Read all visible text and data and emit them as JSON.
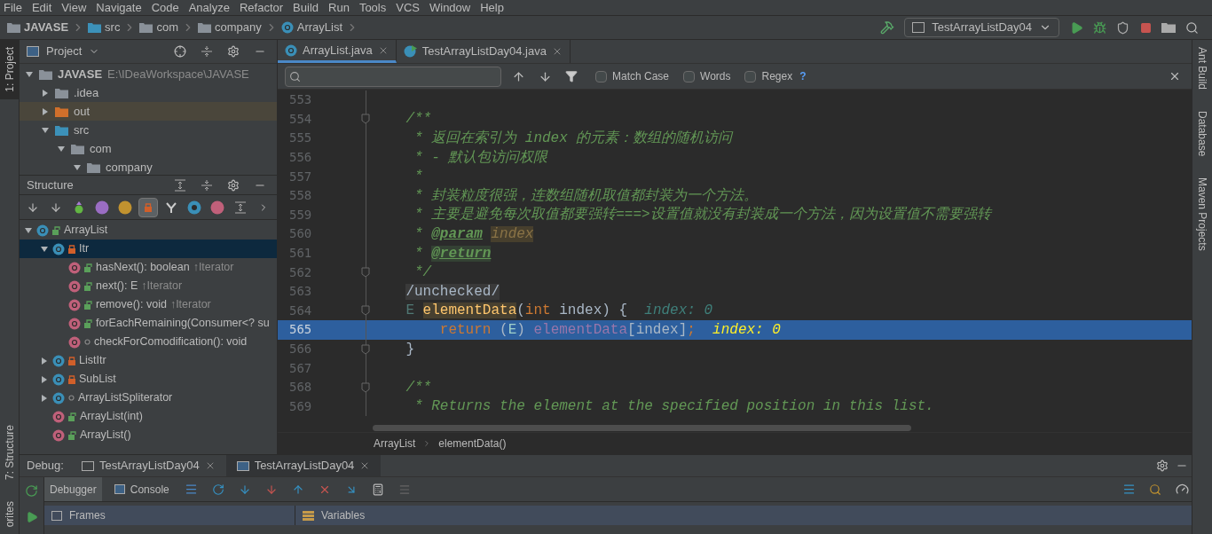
{
  "menu": [
    "File",
    "Edit",
    "View",
    "Navigate",
    "Code",
    "Analyze",
    "Refactor",
    "Build",
    "Run",
    "Tools",
    "VCS",
    "Window",
    "Help"
  ],
  "nav_breadcrumbs": [
    {
      "label": "JAVASE",
      "kind": "project"
    },
    {
      "label": "src",
      "kind": "source"
    },
    {
      "label": "com",
      "kind": "package"
    },
    {
      "label": "company",
      "kind": "package"
    },
    {
      "label": "ArrayList",
      "kind": "class"
    }
  ],
  "run_config": {
    "label": "TestArrayListDay04"
  },
  "left_strip": {
    "top": [
      {
        "label": "1: Project",
        "selected": true
      }
    ],
    "bottom": [
      {
        "label": "7: Structure",
        "selected": false
      },
      {
        "label": "orites",
        "selected": false
      }
    ]
  },
  "project_panel": {
    "title": "Project",
    "tree": [
      {
        "label": "JAVASE",
        "path": "E:\\IDeaWorkspace\\JAVASE",
        "kind": "project",
        "expanded": true,
        "children": [
          {
            "label": ".idea",
            "kind": "folder",
            "expanded": false
          },
          {
            "label": "out",
            "kind": "excluded_folder",
            "expanded": false
          },
          {
            "label": "src",
            "kind": "source",
            "expanded": true,
            "children": [
              {
                "label": "com",
                "kind": "package",
                "expanded": true,
                "children": [
                  {
                    "label": "company",
                    "kind": "package",
                    "expanded": true
                  }
                ]
              }
            ]
          }
        ]
      }
    ]
  },
  "structure_panel": {
    "title": "Structure",
    "tree": [
      {
        "label": "ArrayList",
        "kind": "public_class",
        "expanded": true,
        "selected": false,
        "children": [
          {
            "label": "Itr",
            "kind": "private_class",
            "expanded": true,
            "selected": true,
            "children": [
              {
                "label": "hasNext(): boolean",
                "detail": "↑Iterator",
                "kind": "public_method",
                "selected": false
              },
              {
                "label": "next(): E",
                "detail": "↑Iterator",
                "kind": "public_method",
                "selected": false
              },
              {
                "label": "remove(): void",
                "detail": "↑Iterator",
                "kind": "public_method",
                "selected": false
              },
              {
                "label": "forEachRemaining(Consumer<? su",
                "kind": "public_method",
                "selected": false
              },
              {
                "label": "checkForComodification(): void",
                "kind": "package_method",
                "selected": false
              }
            ]
          },
          {
            "label": "ListItr",
            "kind": "private_class",
            "expanded": false,
            "selected": false
          },
          {
            "label": "SubList",
            "kind": "private_class",
            "expanded": false,
            "selected": false
          },
          {
            "label": "ArrayListSpliterator",
            "kind": "package_class",
            "expanded": false,
            "selected": false
          },
          {
            "label": "ArrayList(int)",
            "kind": "public_method",
            "selected": false
          },
          {
            "label": "ArrayList()",
            "kind": "public_method",
            "selected": false
          }
        ]
      }
    ]
  },
  "editor_tabs": [
    {
      "label": "ArrayList.java",
      "kind": "class",
      "selected": true
    },
    {
      "label": "TestArrayListDay04.java",
      "kind": "runnable",
      "selected": false
    }
  ],
  "find_bar": {
    "options": [
      {
        "label": "Match Case",
        "checked": false
      },
      {
        "label": "Words",
        "checked": false
      },
      {
        "label": "Regex",
        "checked": false
      }
    ],
    "help": "?"
  },
  "code": [
    {
      "number": "553",
      "fold": false,
      "current": false
    },
    {
      "number": "554",
      "fold": true,
      "current": false,
      "tokens": [
        {
          "text": "/**",
          "kind": "comment"
        }
      ]
    },
    {
      "number": "555",
      "fold": false,
      "current": false,
      "tokens": [
        {
          "text": " * 返回在索引为 index 的元素：数组的随机访问",
          "kind": "comment"
        }
      ]
    },
    {
      "number": "556",
      "fold": false,
      "current": false,
      "tokens": [
        {
          "text": " * - 默认包访问权限",
          "kind": "comment"
        }
      ]
    },
    {
      "number": "557",
      "fold": false,
      "current": false,
      "tokens": [
        {
          "text": " *",
          "kind": "comment"
        }
      ]
    },
    {
      "number": "558",
      "fold": false,
      "current": false,
      "tokens": [
        {
          "text": " * 封装粒度很强，连数组随机取值都封装为一个方法。",
          "kind": "comment"
        }
      ]
    },
    {
      "number": "559",
      "fold": false,
      "current": false,
      "tokens": [
        {
          "text": " * 主要是避免每次取值都要强转===>设置值就没有封装成一个方法，因为设置值不需要强转",
          "kind": "comment"
        }
      ]
    },
    {
      "number": "560",
      "fold": false,
      "current": false,
      "tokens": [
        {
          "text": " * ",
          "kind": "comment"
        },
        {
          "text": "@param",
          "kind": "doctag"
        },
        {
          "text": "index",
          "kind": "docparam"
        }
      ]
    },
    {
      "number": "561",
      "fold": false,
      "current": false,
      "tokens": [
        {
          "text": " * ",
          "kind": "comment"
        },
        {
          "text": "@return",
          "kind": "doctag_marked"
        }
      ]
    },
    {
      "number": "562",
      "fold": true,
      "current": false,
      "tokens": [
        {
          "text": " */",
          "kind": "comment"
        }
      ]
    },
    {
      "number": "563",
      "fold": false,
      "current": false,
      "tokens": [
        {
          "text": "/unchecked/",
          "kind": "folded"
        }
      ]
    },
    {
      "number": "564",
      "fold": true,
      "current": false,
      "tokens": [
        {
          "text": "E ",
          "kind": "typeparam"
        },
        {
          "text": "elementData",
          "kind": "method_decl"
        },
        {
          "text": "(",
          "kind": "plain"
        },
        {
          "text": "int",
          "kind": "keyword"
        },
        {
          "text": " index) {  ",
          "kind": "plain"
        },
        {
          "text": "index: 0",
          "kind": "hint"
        }
      ]
    },
    {
      "number": "565",
      "fold": false,
      "current": true,
      "tokens": [
        {
          "text": "    return",
          "kind": "keyword"
        },
        {
          "text": " (",
          "kind": "plain"
        },
        {
          "text": "E",
          "kind": "typeparam"
        },
        {
          "text": ") ",
          "kind": "plain"
        },
        {
          "text": "elementData",
          "kind": "field"
        },
        {
          "text": "[index]",
          "kind": "plain"
        },
        {
          "text": ";  ",
          "kind": "keyword"
        },
        {
          "text": "index: 0",
          "kind": "hint_current"
        }
      ]
    },
    {
      "number": "566",
      "fold": true,
      "current": false,
      "tokens": [
        {
          "text": "}",
          "kind": "plain"
        }
      ]
    },
    {
      "number": "567",
      "fold": false,
      "current": false
    },
    {
      "number": "568",
      "fold": true,
      "current": false,
      "tokens": [
        {
          "text": "/**",
          "kind": "comment"
        }
      ]
    },
    {
      "number": "569",
      "fold": false,
      "current": false,
      "tokens": [
        {
          "text": " * Returns the element at the specified position in this list.",
          "kind": "comment"
        }
      ]
    }
  ],
  "editor_breadcrumbs": [
    "ArrayList",
    "elementData()"
  ],
  "right_strip": [
    "Ant Build",
    "Database",
    "Maven Projects"
  ],
  "debug": {
    "title": "Debug:",
    "tabs": [
      {
        "label": "TestArrayListDay04",
        "selected": false
      },
      {
        "label": "TestArrayListDay04",
        "selected": true
      }
    ],
    "subtabs": [
      {
        "label": "Debugger",
        "kind": "debugger",
        "selected": true
      },
      {
        "label": "Console",
        "kind": "console",
        "selected": false
      }
    ],
    "frames": "Frames",
    "variables": "Variables"
  }
}
